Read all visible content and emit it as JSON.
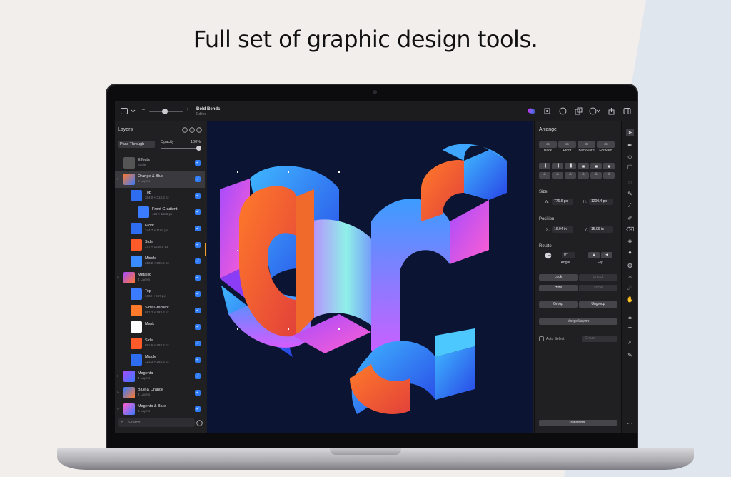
{
  "headline": "Full set of graphic design tools.",
  "colors": {
    "accent": "#2f7cf6",
    "canvas_bg": "#0b1533",
    "panel_bg": "#202022"
  },
  "toolbar": {
    "doc_title": "Bold Bends",
    "doc_status": "Edited",
    "left_icons": [
      "sidebar-icon",
      "chevron-down-icon",
      "zoom-slider"
    ],
    "right_icons": [
      "color-icon",
      "select-icon",
      "info-icon",
      "share-icon",
      "more-icon",
      "export-icon",
      "sidebar-right-icon"
    ]
  },
  "layers_panel": {
    "title": "Layers",
    "blend_mode": "Pass Through",
    "opacity_label": "Opacity",
    "opacity_value": "100%",
    "search_placeholder": "Search",
    "layers": [
      {
        "name": "Effects",
        "sub": "Scale",
        "indent": 0,
        "group": false,
        "selected": false
      },
      {
        "name": "Orange & Blue",
        "sub": "3 Layers",
        "indent": 0,
        "group": true,
        "selected": true
      },
      {
        "name": "Top",
        "sub": "384.0 × 313.3 px",
        "indent": 1,
        "group": false,
        "selected": false
      },
      {
        "name": "Front Gradient",
        "sub": "420 × 1186 px",
        "indent": 2,
        "group": false,
        "selected": false
      },
      {
        "name": "Front",
        "sub": "344.7 × 1107 px",
        "indent": 1,
        "group": false,
        "selected": false
      },
      {
        "name": "Side",
        "sub": "377 × 1238.6 px",
        "indent": 1,
        "group": false,
        "selected": false
      },
      {
        "name": "Middle",
        "sub": "313.2 × 590.5 px",
        "indent": 1,
        "group": false,
        "selected": false
      },
      {
        "name": "Metallic",
        "sub": "4 Layers",
        "indent": 0,
        "group": true,
        "selected": false
      },
      {
        "name": "Top",
        "sub": "1068 × 957 px",
        "indent": 1,
        "group": false,
        "selected": false
      },
      {
        "name": "Side Gradient",
        "sub": "861.2 × 783.2 px",
        "indent": 1,
        "group": false,
        "selected": false
      },
      {
        "name": "Mask",
        "sub": "",
        "indent": 1,
        "group": false,
        "selected": false
      },
      {
        "name": "Side",
        "sub": "881.6 × 783.2 px",
        "indent": 1,
        "group": false,
        "selected": false
      },
      {
        "name": "Middle",
        "sub": "323.3 × 264.8 px",
        "indent": 1,
        "group": false,
        "selected": false
      },
      {
        "name": "Magenta",
        "sub": "4 Layers",
        "indent": 0,
        "group": true,
        "selected": false
      },
      {
        "name": "Blue & Orange",
        "sub": "4 Layers",
        "indent": 0,
        "group": true,
        "selected": false
      },
      {
        "name": "Magenta & Blue",
        "sub": "3 Layers",
        "indent": 0,
        "group": true,
        "selected": false
      }
    ]
  },
  "arrange_panel": {
    "title": "Arrange",
    "order_buttons": [
      "Back",
      "Front",
      "Backward",
      "Forward"
    ],
    "size_label": "Size",
    "width_label": "W:",
    "width_value": "776.6 px",
    "height_label": "H:",
    "height_value": "1200.4 px",
    "position_label": "Position",
    "x_label": "X:",
    "x_value": "16.94 in",
    "y_label": "Y:",
    "y_value": "15.09 in",
    "rotate_label": "Rotate",
    "angle_value": "0°",
    "angle_label": "Angle",
    "flip_label": "Flip",
    "lock": "Lock",
    "unlock": "Unlock",
    "hide": "Hide",
    "show": "Show",
    "group": "Group",
    "ungroup": "Ungroup",
    "merge_layers": "Merge Layers",
    "auto_select": "Auto Select:",
    "auto_select_value": "Group",
    "transform": "Transform..."
  },
  "tools": [
    "pointer-icon",
    "pen-icon",
    "node-icon",
    "shape-icon",
    "lasso-icon",
    "eyedropper-icon",
    "brush-icon",
    "pencil-icon",
    "eraser-icon",
    "bucket-icon",
    "fill-icon",
    "blur-icon",
    "sun-icon",
    "smudge-icon",
    "hand-icon",
    "crop-icon",
    "text-icon",
    "zoom-icon",
    "color-picker-icon",
    "more-icon"
  ]
}
